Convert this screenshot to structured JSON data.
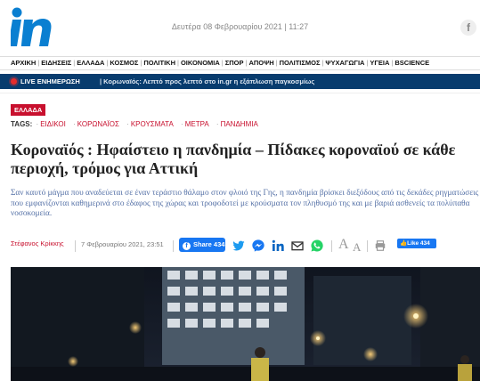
{
  "header": {
    "logo_text": "in",
    "date": "Δευτέρα 08 Φεβρουαρίου 2021 | 11:27",
    "facebook_icon": "f"
  },
  "nav": {
    "items": [
      "ΑΡΧΙΚΗ",
      "ΕΙΔΗΣΕΙΣ",
      "ΕΛΛΑΔΑ",
      "ΚΟΣΜΟΣ",
      "ΠΟΛΙΤΙΚΗ",
      "ΟΙΚΟΝΟΜΙΑ",
      "ΣΠΟΡ",
      "ΑΠΟΨΗ",
      "ΠΟΛΙΤΙΣΜΟΣ",
      "ΨΥΧΑΓΩΓΙΑ",
      "ΥΓΕΙΑ",
      "BSCIENCE"
    ]
  },
  "live": {
    "label": "LIVE ΕΝΗΜΕΡΩΣΗ",
    "text": "| Κορωναϊός: Λεπτό προς λεπτό στο in.gr η εξάπλωση παγκοσμίως"
  },
  "article": {
    "category": "ΕΛΛΑΔΑ",
    "tags_label": "TAGS:",
    "tags": [
      "ΕΙΔΙΚΟΙ",
      "ΚΟΡΩΝΑΪΟΣ",
      "ΚΡΟΥΣΜΑΤΑ",
      "ΜΕΤΡΑ",
      "ΠΑΝΔΗΜΙΑ"
    ],
    "title": "Κοροναϊός : Ηφαίστειο η πανδημία – Πίδακες κοροναϊού σε κάθε περιοχή, τρόμος για Αττική",
    "lead": "Σαν καυτό μάγμα που αναδεύεται σε έναν τεράστιο θάλαμο στον φλοιό της Γης, η πανδημία βρίσκει διεξόδους από τις δεκάδες ρηγματώσεις που εμφανίζονται καθημερινά στο έδαφος της χώρας και τροφοδοτεί με κρούσματα τον πληθυσμό της και με βαριά ασθενείς τα πολύπαθα νοσοκομεία.",
    "author": "Στέφανος Κρίκκης",
    "date": "7 Φεβρουαρίου 2021, 23:51",
    "share_label": "Share 434",
    "like_label": "Like 434",
    "font_large": "A",
    "font_small": "A"
  },
  "colors": {
    "brand_blue": "#0a7fd1",
    "live_bar": "#083c6e",
    "accent_red": "#c8102e",
    "facebook": "#1877f2"
  }
}
